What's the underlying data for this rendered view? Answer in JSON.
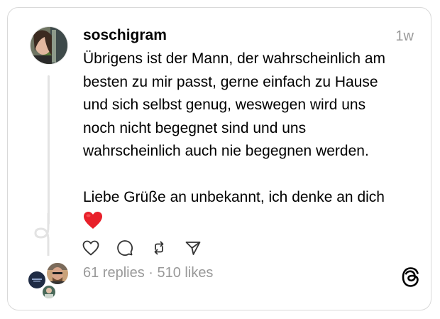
{
  "post": {
    "username": "soschigram",
    "timestamp": "1w",
    "lines": [
      "Übrigens ist der Mann, der wahrscheinlich am",
      "besten zu mir passt, gerne einfach zu Hause",
      "und sich selbst genug, weswegen wird uns",
      "noch nicht begegnet sind und uns",
      "wahrscheinlich auch nie begegnen werden."
    ],
    "closing": "Liebe Grüße an unbekannt, ich denke an dich",
    "emoji": "heart"
  },
  "actions": {
    "icons": [
      "heart-icon",
      "comment-icon",
      "repost-icon",
      "share-icon"
    ]
  },
  "stats": {
    "replies": "61 replies",
    "separator": " · ",
    "likes": "510 likes"
  },
  "colors": {
    "text": "#000000",
    "muted": "#999999",
    "border": "#d9d9d9",
    "heart": "#e8202a"
  }
}
